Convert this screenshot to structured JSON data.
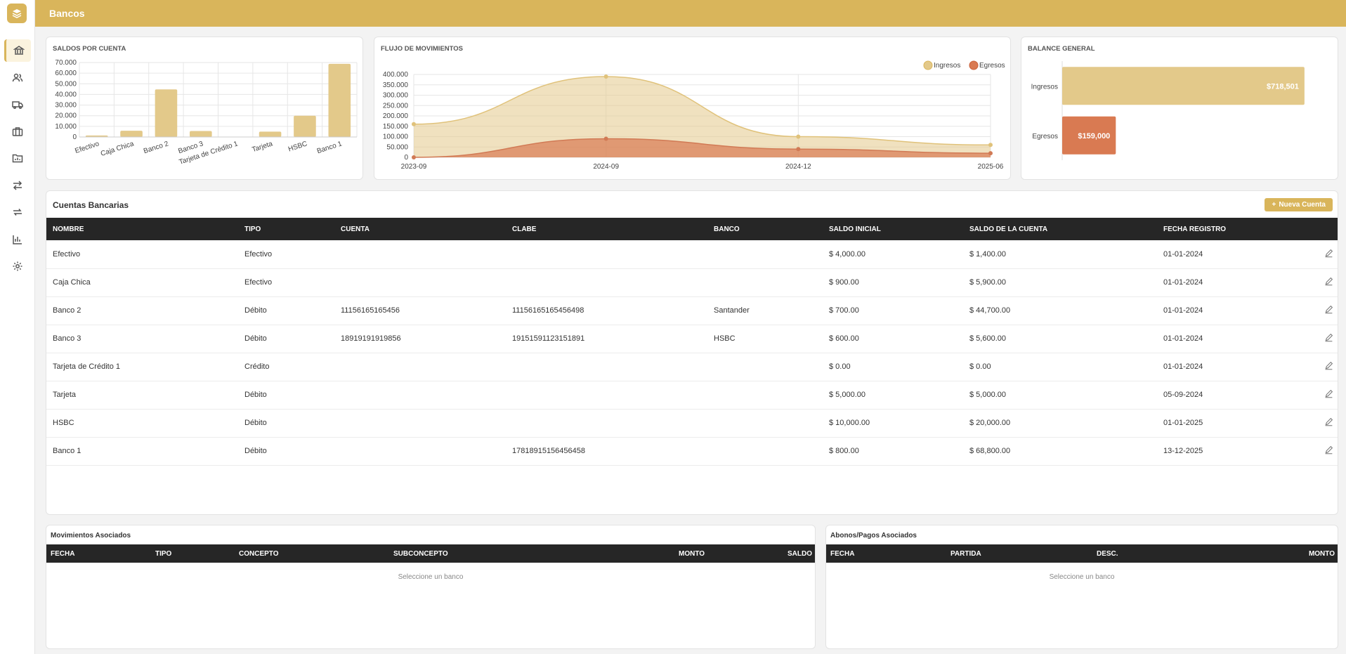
{
  "app": {
    "title": "Bancos"
  },
  "sidebar": {
    "items": [
      {
        "icon": "bank-icon",
        "active": true
      },
      {
        "icon": "users-icon",
        "active": false
      },
      {
        "icon": "truck-icon",
        "active": false
      },
      {
        "icon": "briefcase-icon",
        "active": false
      },
      {
        "icon": "folder-chart-icon",
        "active": false
      },
      {
        "icon": "transfer-icon",
        "active": false
      },
      {
        "icon": "repeat-icon",
        "active": false
      },
      {
        "icon": "bar-chart-icon",
        "active": false
      },
      {
        "icon": "gear-icon",
        "active": false
      }
    ]
  },
  "colors": {
    "accent": "#d9b55b",
    "ingresos": "#e3c98a",
    "egresos": "#d97a52",
    "header_dark": "#262626"
  },
  "charts": {
    "saldos": {
      "title": "SALDOS POR CUENTA"
    },
    "flujo": {
      "title": "FLUJO DE MOVIMIENTOS"
    },
    "balance": {
      "title": "BALANCE GENERAL"
    }
  },
  "chart_data": [
    {
      "type": "bar",
      "title": "SALDOS POR CUENTA",
      "categories": [
        "Efectivo",
        "Caja Chica",
        "Banco 2",
        "Banco 3",
        "Tarjeta de Crédito 1",
        "Tarjeta",
        "HSBC",
        "Banco 1"
      ],
      "values": [
        1400,
        5900,
        44700,
        5600,
        0,
        5000,
        20000,
        68800
      ],
      "ylim": [
        0,
        70000
      ],
      "yticks": [
        "0",
        "10.000",
        "20.000",
        "30.000",
        "40.000",
        "50.000",
        "60.000",
        "70.000"
      ],
      "grid": true
    },
    {
      "type": "area",
      "title": "FLUJO DE MOVIMIENTOS",
      "x": [
        "2023-09",
        "2024-09",
        "2024-12",
        "2025-06"
      ],
      "series": [
        {
          "name": "Ingresos",
          "values": [
            160000,
            390000,
            100000,
            60000
          ]
        },
        {
          "name": "Egresos",
          "values": [
            0,
            90000,
            40000,
            20000
          ]
        }
      ],
      "ylim": [
        0,
        400000
      ],
      "yticks": [
        "0",
        "50.000",
        "100.000",
        "150.000",
        "200.000",
        "250.000",
        "300.000",
        "350.000",
        "400.000"
      ],
      "legend": "top-right",
      "grid": true
    },
    {
      "type": "bar",
      "orientation": "horizontal",
      "title": "BALANCE GENERAL",
      "categories": [
        "Ingresos",
        "Egresos"
      ],
      "values": [
        718501,
        159000
      ],
      "labels": [
        "$718,501",
        "$159,000"
      ]
    }
  ],
  "accounts": {
    "title": "Cuentas Bancarias",
    "new_button": "Nueva Cuenta",
    "headers": [
      "NOMBRE",
      "TIPO",
      "CUENTA",
      "CLABE",
      "BANCO",
      "SALDO INICIAL",
      "SALDO DE LA CUENTA",
      "FECHA REGISTRO"
    ],
    "rows": [
      [
        "Efectivo",
        "Efectivo",
        "",
        "",
        "",
        "$ 4,000.00",
        "$ 1,400.00",
        "01-01-2024"
      ],
      [
        "Caja Chica",
        "Efectivo",
        "",
        "",
        "",
        "$ 900.00",
        "$ 5,900.00",
        "01-01-2024"
      ],
      [
        "Banco 2",
        "Débito",
        "11156165165456",
        "11156165165456498",
        "Santander",
        "$ 700.00",
        "$ 44,700.00",
        "01-01-2024"
      ],
      [
        "Banco 3",
        "Débito",
        "18919191919856",
        "19151591123151891",
        "HSBC",
        "$ 600.00",
        "$ 5,600.00",
        "01-01-2024"
      ],
      [
        "Tarjeta de Crédito 1",
        "Crédito",
        "",
        "",
        "",
        "$ 0.00",
        "$ 0.00",
        "01-01-2024"
      ],
      [
        "Tarjeta",
        "Débito",
        "",
        "",
        "",
        "$ 5,000.00",
        "$ 5,000.00",
        "05-09-2024"
      ],
      [
        "HSBC",
        "Débito",
        "",
        "",
        "",
        "$ 10,000.00",
        "$ 20,000.00",
        "01-01-2025"
      ],
      [
        "Banco 1",
        "Débito",
        "",
        "17818915156456458",
        "",
        "$ 800.00",
        "$ 68,800.00",
        "13-12-2025"
      ]
    ]
  },
  "movimientos": {
    "title": "Movimientos Asociados",
    "headers": [
      "FECHA",
      "TIPO",
      "CONCEPTO",
      "SUBCONCEPTO",
      "MONTO",
      "SALDO"
    ],
    "empty": "Seleccione un banco"
  },
  "abonos": {
    "title": "Abonos/Pagos Asociados",
    "headers": [
      "FECHA",
      "PARTIDA",
      "DESC.",
      "MONTO"
    ],
    "empty": "Seleccione un banco"
  }
}
